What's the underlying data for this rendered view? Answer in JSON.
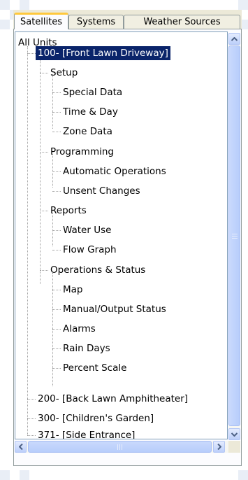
{
  "tabs": [
    {
      "label": "Satellites"
    },
    {
      "label": "Systems"
    },
    {
      "label": "Weather Sources"
    }
  ],
  "tree": {
    "root": "All Units",
    "unit_100": "100- [Front Lawn  Driveway]",
    "setup": "Setup",
    "special_data": "Special Data",
    "time_day": "Time & Day",
    "zone_data": "Zone Data",
    "programming": "Programming",
    "automatic_operations": "Automatic Operations",
    "unsent_changes": "Unsent Changes",
    "reports": "Reports",
    "water_use": "Water Use",
    "flow_graph": "Flow Graph",
    "operations_status": "Operations & Status",
    "map": "Map",
    "manual_output_status": "Manual/Output Status",
    "alarms": "Alarms",
    "rain_days": "Rain Days",
    "percent_scale": "Percent Scale",
    "unit_200": "200- [Back Lawn  Amphitheater]",
    "unit_300": "300- [Children's Garden]",
    "unit_371": "371- [Side Entrance]"
  },
  "colors": {
    "selection": "#0a246a",
    "active_tab_accent": "#ffc83c",
    "scroll_thumb": "#bccffa"
  },
  "icons": {
    "scroll_up": "up-arrow",
    "scroll_down": "down-arrow",
    "scroll_left": "left-arrow",
    "scroll_right": "right-arrow"
  }
}
